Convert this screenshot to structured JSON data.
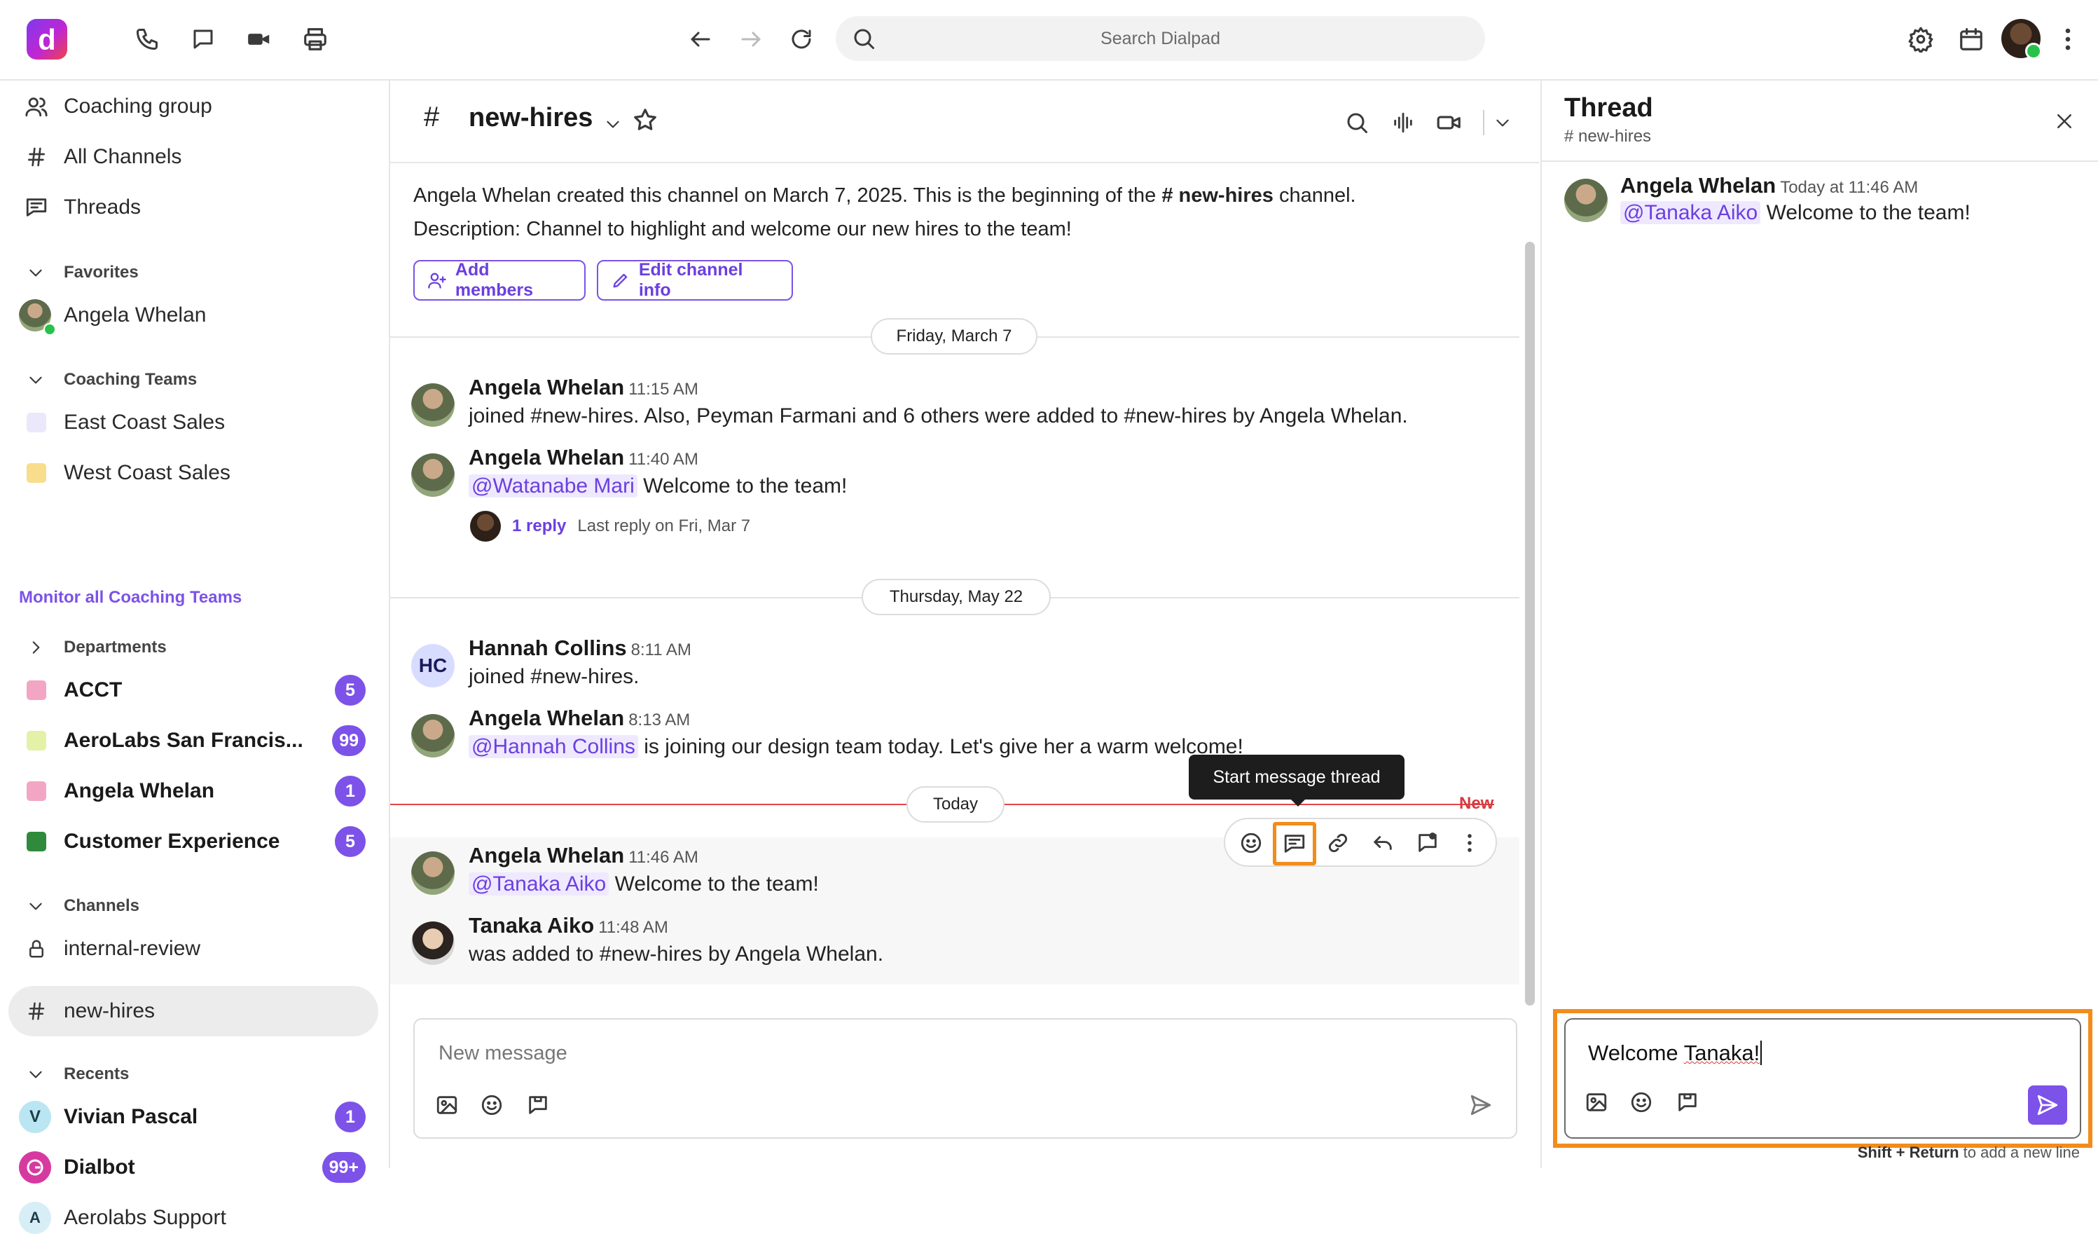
{
  "topbar": {
    "logo_letter": "d",
    "search_placeholder": "Search Dialpad"
  },
  "sidebar": {
    "top_items": [
      {
        "label": "Coaching group",
        "icon": "people-icon"
      },
      {
        "label": "All Channels",
        "icon": "hash-icon"
      },
      {
        "label": "Threads",
        "icon": "threads-icon"
      }
    ],
    "favorites": {
      "title": "Favorites",
      "items": [
        {
          "label": "Angela Whelan"
        }
      ]
    },
    "coaching_teams": {
      "title": "Coaching Teams",
      "items": [
        {
          "label": "East Coast Sales",
          "color": "#ece8fb"
        },
        {
          "label": "West Coast Sales",
          "color": "#f8dd8c"
        }
      ],
      "monitor_link": "Monitor all Coaching Teams"
    },
    "departments": {
      "title": "Departments",
      "items": [
        {
          "label": "ACCT",
          "badge": "5",
          "color": "#f3a6c4"
        },
        {
          "label": "AeroLabs San Francis...",
          "badge": "99",
          "color": "#e3f2a6"
        },
        {
          "label": "Angela Whelan",
          "badge": "1",
          "color": "#f3a6c4"
        },
        {
          "label": "Customer Experience",
          "badge": "5",
          "color": "#2f8a3b"
        }
      ]
    },
    "channels": {
      "title": "Channels",
      "items": [
        {
          "label": "internal-review",
          "icon": "lock-icon"
        },
        {
          "label": "new-hires",
          "icon": "hash-icon",
          "active": true
        }
      ]
    },
    "recents": {
      "title": "Recents",
      "items": [
        {
          "label": "Vivian Pascal",
          "badge": "1",
          "avatar_letter": "V",
          "avatar_color": "#b9e6f2"
        },
        {
          "label": "Dialbot",
          "badge": "99+",
          "avatar_color": "#d63aa0"
        },
        {
          "label": "Aerolabs Support",
          "avatar_letter": "A",
          "avatar_color": "#d7eef7"
        }
      ]
    }
  },
  "channel": {
    "hash": "#",
    "name": "new-hires",
    "intro_line1_a": "Angela Whelan created this channel on March 7, 2025. This is the beginning of the ",
    "intro_line1_channel": "# new-hires",
    "intro_line1_b": " channel.",
    "intro_line2": "Description: Channel to highlight and welcome our new hires to the team!",
    "add_members": "Add members",
    "edit_channel_info": "Edit channel info",
    "dates": [
      "Friday, March 7",
      "Thursday, May 22",
      "Today"
    ],
    "new_label": "New",
    "tooltip": "Start message thread",
    "composer_placeholder": "New message"
  },
  "messages": [
    {
      "author": "Angela Whelan",
      "time": "11:15 AM",
      "text": "joined #new-hires. Also, Peyman Farmani and 6 others were added to #new-hires by Angela Whelan."
    },
    {
      "author": "Angela Whelan",
      "time": "11:40 AM",
      "mention": "@Watanabe Mari",
      "text": " Welcome to the team!",
      "reply_count": "1 reply",
      "reply_meta": "Last reply on Fri, Mar 7"
    },
    {
      "author": "Hannah Collins",
      "initials": "HC",
      "time": "8:11 AM",
      "text": "joined #new-hires."
    },
    {
      "author": "Angela Whelan",
      "time": "8:13 AM",
      "mention": "@Hannah Collins",
      "text": " is joining our design team today. Let's give her a warm welcome!"
    },
    {
      "author": "Angela Whelan",
      "time": "11:46 AM",
      "mention": "@Tanaka Aiko",
      "text": " Welcome to the team!"
    },
    {
      "author": "Tanaka Aiko",
      "time": "11:48 AM",
      "text": "was added to #new-hires by Angela Whelan."
    }
  ],
  "thread": {
    "title": "Thread",
    "channel": "# new-hires",
    "message": {
      "author": "Angela Whelan",
      "time": "Today at 11:46 AM",
      "mention": "@Tanaka Aiko",
      "text": " Welcome to the team!"
    },
    "composer_value_a": "Welcome ",
    "composer_value_b": "Tanaka!",
    "hint_bold": "Shift + Return",
    "hint_rest": " to add a new line"
  },
  "colors": {
    "accent": "#7c52e8",
    "highlight": "#f28c1b",
    "new_line": "#e0464a"
  }
}
